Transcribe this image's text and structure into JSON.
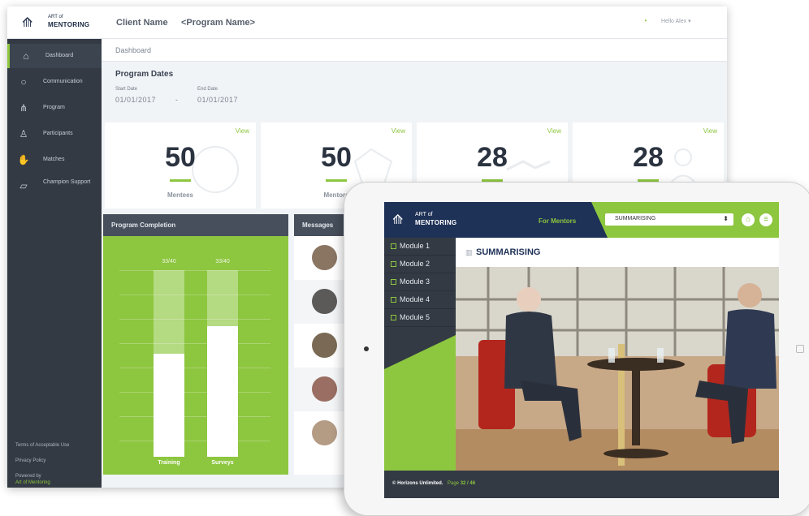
{
  "dashboard": {
    "logo": {
      "small": "ART of",
      "large": "MENTORING"
    },
    "header": {
      "client_name": "Client Name",
      "program_name": "<Program Name>",
      "greeting": "Hello Alex ▾"
    },
    "sidebar": {
      "items": [
        {
          "label": "Dashboard",
          "icon": "home-icon"
        },
        {
          "label": "Communication",
          "icon": "chat-icon"
        },
        {
          "label": "Program",
          "icon": "hierarchy-icon"
        },
        {
          "label": "Participants",
          "icon": "user-icon"
        },
        {
          "label": "Matches",
          "icon": "handshake-icon"
        },
        {
          "label": "Champion Support",
          "icon": "support-icon"
        }
      ],
      "footer": {
        "terms": "Terms of Acceptable Use",
        "privacy": "Privacy Policy",
        "powered_by": "Powered by",
        "powered_name": "Art of Mentoring"
      }
    },
    "breadcrumb": "Dashboard",
    "program_dates": {
      "title": "Program Dates",
      "start_label": "Start Date",
      "start_value": "01/01/2017",
      "separator": "-",
      "end_label": "End Date",
      "end_value": "01/01/2017"
    },
    "stats": [
      {
        "value": "50",
        "label": "Mentees",
        "link": "View"
      },
      {
        "value": "50",
        "label": "Mentors",
        "link": "View"
      },
      {
        "value": "28",
        "label": "",
        "link": "View"
      },
      {
        "value": "28",
        "label": "",
        "link": "View"
      }
    ],
    "program_completion": {
      "title": "Program Completion",
      "bars": [
        {
          "label": "Training",
          "value_text": "33/40",
          "fraction": 0.55
        },
        {
          "label": "Surveys",
          "value_text": "33/40",
          "fraction": 0.7
        }
      ]
    },
    "messages": {
      "title": "Messages"
    }
  },
  "tablet": {
    "logo": {
      "small": "ART of",
      "large": "MENTORING"
    },
    "for_label": "For Mentors",
    "topic_select": "SUMMARISING",
    "modules": [
      "Module 1",
      "Module 2",
      "Module 3",
      "Module 4",
      "Module 5"
    ],
    "content_title": "SUMMARISING",
    "footer": {
      "copyright": "© Horizons Unlimited.",
      "page_label": "Page",
      "page_value": "32 / 46"
    }
  },
  "colors": {
    "accent_green": "#8dc63f",
    "navy": "#1e3157",
    "sidebar_dark": "#333a44"
  }
}
